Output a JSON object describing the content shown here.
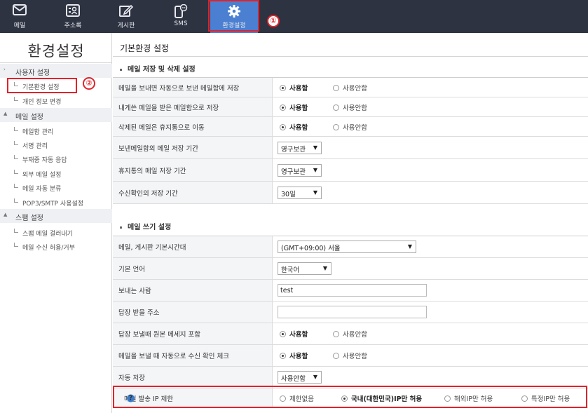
{
  "nav": [
    {
      "label": "메일",
      "icon": "mail-icon"
    },
    {
      "label": "주소록",
      "icon": "address-book-icon"
    },
    {
      "label": "게시판",
      "icon": "edit-board-icon"
    },
    {
      "label": "SMS",
      "icon": "sms-phone-icon"
    },
    {
      "label": "환경설정",
      "icon": "gear-icon",
      "active": true
    }
  ],
  "callouts": [
    "①",
    "②"
  ],
  "sidebar": {
    "title": "환경설정",
    "groups": [
      {
        "label": "사용자 설정",
        "items": [
          "기본환경 설정",
          "개인 정보 변경"
        ]
      },
      {
        "label": "메일 설정",
        "items": [
          "메일함 관리",
          "서명 관리",
          "부재중 자동 응답",
          "외부 메일 설정",
          "메일 자동 분류",
          "POP3/SMTP 사용설정"
        ]
      },
      {
        "label": "스팸 설정",
        "items": [
          "스팸 메일 걸러내기",
          "메일 수신 허용/거부"
        ]
      }
    ]
  },
  "main": {
    "title": "기본환경 설정",
    "section1": {
      "title": "메일 저장 및 삭제 설정",
      "rows": [
        {
          "label": "메일을 보내면 자동으로 보낸 메일함에 저장",
          "options": [
            "사용함",
            "사용안함"
          ],
          "selected": 0
        },
        {
          "label": "내게쓴 메일을 받은 메일함으로 저장",
          "options": [
            "사용함",
            "사용안함"
          ],
          "selected": 0
        },
        {
          "label": "삭제된 메일은 휴지통으로 이동",
          "options": [
            "사용함",
            "사용안함"
          ],
          "selected": 0
        },
        {
          "label": "보낸메일함의 메일 저장 기간",
          "select": "영구보관"
        },
        {
          "label": "휴지통의 메일 저장 기간",
          "select": "영구보관"
        },
        {
          "label": "수신확인의 저장 기간",
          "select": "30일"
        }
      ]
    },
    "section2": {
      "title": "메일 쓰기 설정",
      "rows": [
        {
          "label": "메일, 게시판 기본시간대",
          "select": "(GMT+09:00) 서울"
        },
        {
          "label": "기본 언어",
          "select": "한국어"
        },
        {
          "label": "보내는 사람",
          "input": "test"
        },
        {
          "label": "답장 받을 주소",
          "input": ""
        },
        {
          "label": "답장 보낼때 원본 메세지 포함",
          "options": [
            "사용함",
            "사용안함"
          ],
          "selected": 0
        },
        {
          "label": "메일을 보낼 때 자동으로 수신 확인 체크",
          "options": [
            "사용함",
            "사용안함"
          ],
          "selected": 0
        },
        {
          "label": "자동 저장",
          "select": "사용안함"
        },
        {
          "label": "메일 발송 IP 제한",
          "help": "?",
          "options": [
            "제한없음",
            "국내(대한민국)IP만 허용",
            "해외IP만 허용",
            "특정IP만 허용"
          ],
          "selected": 1
        }
      ]
    }
  },
  "caret": "▼",
  "colors": {
    "nav_bg": "#2e3342",
    "nav_active": "#4a7fd1",
    "highlight": "#e0232b"
  }
}
